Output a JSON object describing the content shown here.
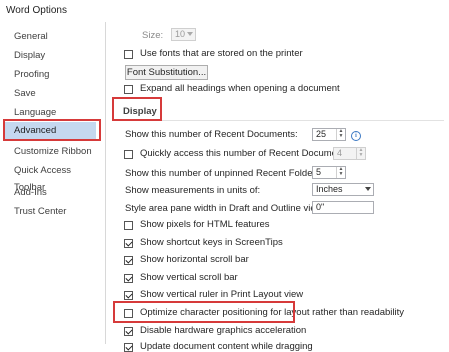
{
  "window": {
    "title": "Word Options"
  },
  "sidebar": {
    "items": [
      {
        "label": "General"
      },
      {
        "label": "Display"
      },
      {
        "label": "Proofing"
      },
      {
        "label": "Save"
      },
      {
        "label": "Language"
      },
      {
        "label": "Advanced"
      },
      {
        "label": "Customize Ribbon"
      },
      {
        "label": "Quick Access Toolbar"
      },
      {
        "label": "Add-Ins"
      },
      {
        "label": "Trust Center"
      }
    ],
    "selected": "Advanced"
  },
  "print_section": {
    "size_label": "Size:",
    "size_value": "10",
    "use_printer_fonts": {
      "label": "Use fonts that are stored on the printer",
      "checked": false
    },
    "font_substitution_button": "Font Substitution...",
    "expand_headings": {
      "label": "Expand all headings when opening a document",
      "checked": false
    }
  },
  "display_section": {
    "header": "Display",
    "recent_docs": {
      "label": "Show this number of Recent Documents:",
      "value": "25"
    },
    "quick_access": {
      "label": "Quickly access this number of Recent Documents:",
      "value": "4",
      "checked": false
    },
    "unpinned_folders": {
      "label": "Show this number of unpinned Recent Folders:",
      "value": "5"
    },
    "measurement_units": {
      "label": "Show measurements in units of:",
      "value": "Inches"
    },
    "style_area": {
      "label": "Style area pane width in Draft and Outline views:",
      "value": "0\""
    },
    "options": [
      {
        "label": "Show pixels for HTML features",
        "checked": false
      },
      {
        "label": "Show shortcut keys in ScreenTips",
        "checked": true
      },
      {
        "label": "Show horizontal scroll bar",
        "checked": true
      },
      {
        "label": "Show vertical scroll bar",
        "checked": true
      },
      {
        "label": "Show vertical ruler in Print Layout view",
        "checked": true
      },
      {
        "label": "Optimize character positioning for layout rather than readability",
        "checked": false
      },
      {
        "label": "Disable hardware graphics acceleration",
        "checked": true
      },
      {
        "label": "Update document content while dragging",
        "checked": true
      }
    ]
  },
  "colors": {
    "highlight": "#d63a3a",
    "selected_bg": "#c5d8ef"
  }
}
